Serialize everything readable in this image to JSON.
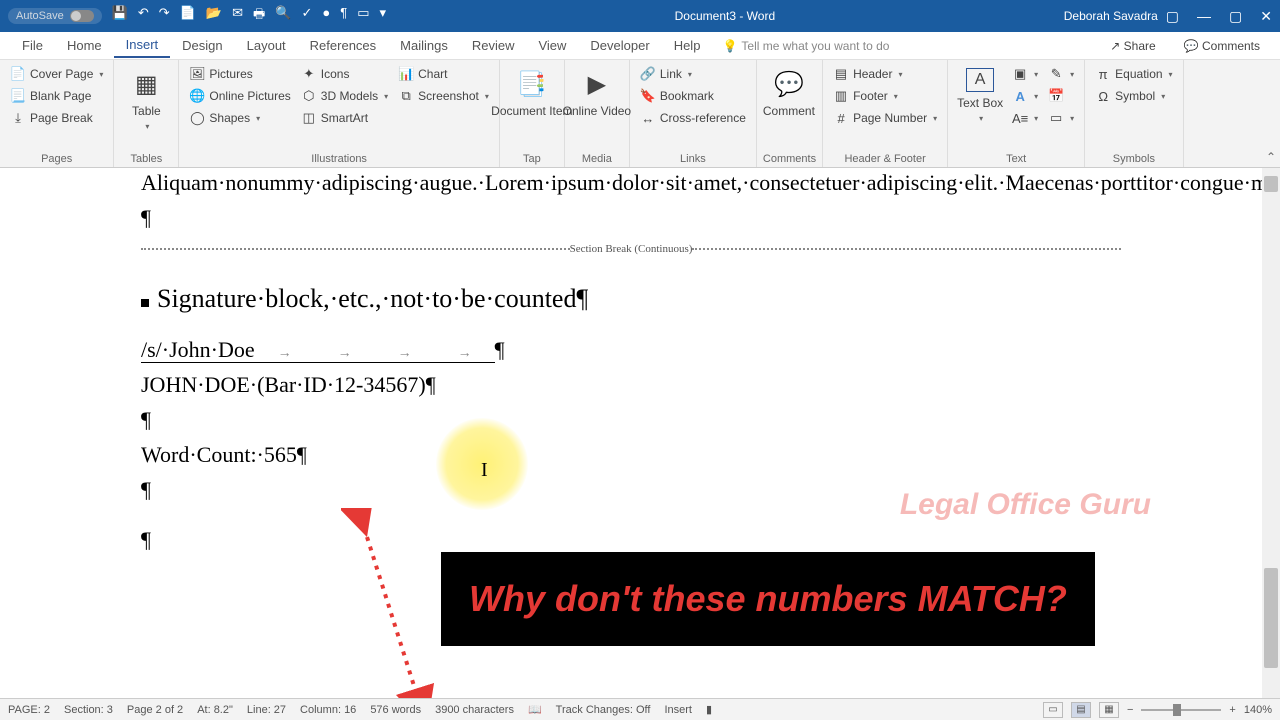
{
  "titlebar": {
    "autosave": "AutoSave",
    "doctitle": "Document3 - Word",
    "user": "Deborah Savadra"
  },
  "tabs": [
    "File",
    "Home",
    "Insert",
    "Design",
    "Layout",
    "References",
    "Mailings",
    "Review",
    "View",
    "Developer",
    "Help"
  ],
  "tellme": "Tell me what you want to do",
  "share": "Share",
  "comments": "Comments",
  "ribbon": {
    "pages": {
      "cover": "Cover Page",
      "blank": "Blank Page",
      "break": "Page Break",
      "label": "Pages"
    },
    "tables": {
      "table": "Table",
      "label": "Tables"
    },
    "illus": {
      "pictures": "Pictures",
      "online": "Online Pictures",
      "shapes": "Shapes",
      "icons": "Icons",
      "models": "3D Models",
      "smart": "SmartArt",
      "chart": "Chart",
      "screenshot": "Screenshot",
      "label": "Illustrations"
    },
    "tap": {
      "item": "Document Item",
      "label": "Tap"
    },
    "media": {
      "video": "Online Video",
      "label": "Media"
    },
    "links": {
      "link": "Link",
      "bookmark": "Bookmark",
      "crossref": "Cross-reference",
      "label": "Links"
    },
    "comments": {
      "comment": "Comment",
      "label": "Comments"
    },
    "hf": {
      "header": "Header",
      "footer": "Footer",
      "pagenum": "Page Number",
      "label": "Header & Footer"
    },
    "text": {
      "textbox": "Text Box",
      "label": "Text"
    },
    "symbols": {
      "equation": "Equation",
      "symbol": "Symbol",
      "label": "Symbols"
    }
  },
  "doc": {
    "p1": "Aliquam·nonummy·adipiscing·augue.·Lorem·ipsum·dolor·sit·amet,·consectetuer·adipiscing·elit.·Maecenas·porttitor·congue·massa.·Fusce·posuere,·magna·sed·pulvinar·ultricies,·purus·lectus·malesuada·libero,·sit·amet·commodo·magna·eros·quis·urna.·Nunc·viverra·imperdiet·enim.",
    "sectionbreak": "Section Break (Continuous)",
    "heading": "Signature·block,·etc.,·not·to·be·counted",
    "sig1": "/s/·John·Doe",
    "sig2": "JOHN·DOE·(Bar·ID·12-34567)",
    "wc": "Word·Count:·565"
  },
  "callout": "Why don't these numbers MATCH?",
  "watermark": "Legal Office Guru",
  "status": {
    "page": "PAGE: 2",
    "section": "Section: 3",
    "pageof": "Page 2 of 2",
    "at": "At: 8.2\"",
    "line": "Line: 27",
    "col": "Column: 16",
    "words": "576 words",
    "chars": "3900 characters",
    "track": "Track Changes: Off",
    "insert": "Insert",
    "zoom": "140%"
  }
}
